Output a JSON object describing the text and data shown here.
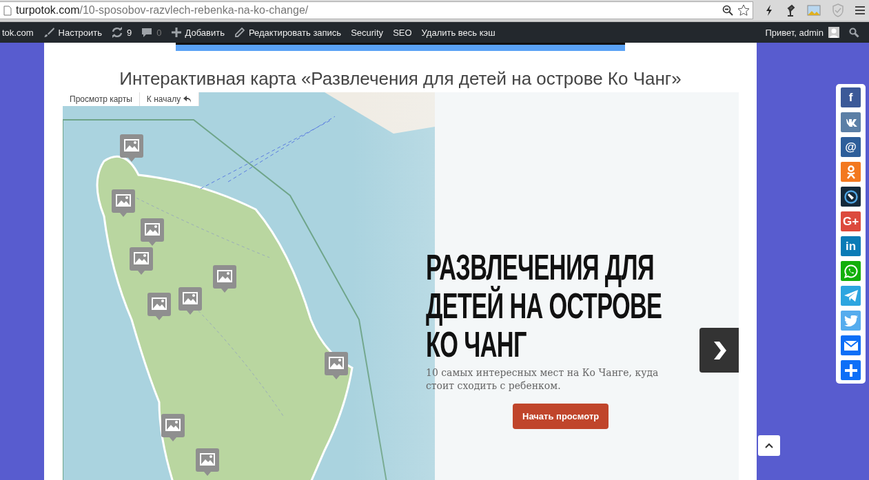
{
  "browser": {
    "url_host": "turpotok.com",
    "url_path": "/10-sposobov-razvlech-rebenka-na-ko-change/"
  },
  "admin_bar": {
    "items": [
      {
        "kind": "site",
        "label": "tok.com"
      },
      {
        "kind": "customize",
        "label": "Настроить"
      },
      {
        "kind": "updates",
        "label": "9"
      },
      {
        "kind": "comments",
        "label": "0"
      },
      {
        "kind": "new",
        "label": "Добавить"
      },
      {
        "kind": "edit",
        "label": "Редактировать запись"
      },
      {
        "kind": "plain",
        "label": "Security"
      },
      {
        "kind": "plain",
        "label": "SEO"
      },
      {
        "kind": "plain",
        "label": "Удалить весь кэш"
      }
    ],
    "greeting": "Привет, admin"
  },
  "page_title": "Интерактивная карта «Развлечения для детей на острове Ко Чанг»",
  "map": {
    "controls": [
      {
        "kind": "view",
        "label": "Просмотр карты"
      },
      {
        "kind": "home",
        "label": "К началу"
      }
    ],
    "intro": {
      "heading": "РАЗВЛЕЧЕНИЯ ДЛЯ ДЕТЕЙ НА ОСТРОВЕ КО ЧАНГ",
      "subtitle": "10 самых интересных мест на Ко Чанге, куда стоит сходить с ребенком.",
      "button": "Начать просмотр"
    }
  },
  "share": [
    {
      "color": "#3b5998",
      "glyph": "f"
    },
    {
      "kind": "vk",
      "color": "#5b7fa6"
    },
    {
      "color": "#2d5e9a",
      "glyph": "@"
    },
    {
      "kind": "ok",
      "color": "#f3781f"
    },
    {
      "kind": "bookmark",
      "color": "#15293a"
    },
    {
      "color": "#dc4a3d",
      "glyph": "G+"
    },
    {
      "color": "#0a7bb6",
      "glyph": "in"
    },
    {
      "kind": "whatsapp",
      "color": "#12af0a"
    },
    {
      "kind": "telegram",
      "color": "#2ca5e0"
    },
    {
      "kind": "twitter",
      "color": "#55acee"
    },
    {
      "kind": "email",
      "color": "#0d6ff7"
    },
    {
      "kind": "more",
      "color": "#0d6ff7"
    }
  ]
}
